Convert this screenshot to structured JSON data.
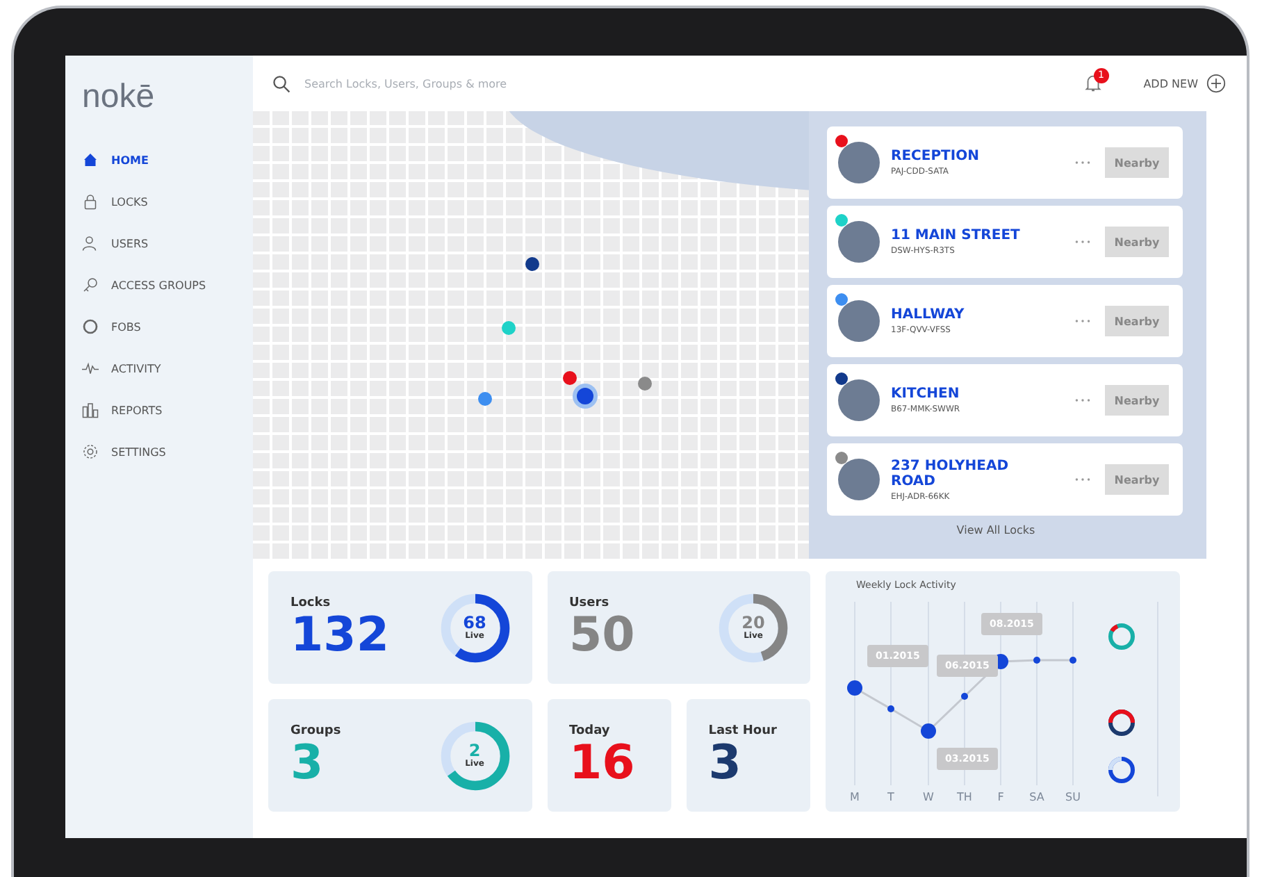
{
  "logo": "nokē",
  "nav": [
    {
      "label": "HOME",
      "selected": true
    },
    {
      "label": "LOCKS",
      "selected": false
    },
    {
      "label": "USERS",
      "selected": false
    },
    {
      "label": "ACCESS GROUPS",
      "selected": false
    },
    {
      "label": "FOBS",
      "selected": false
    },
    {
      "label": "ACTIVITY",
      "selected": false
    },
    {
      "label": "REPORTS",
      "selected": false
    },
    {
      "label": "SETTINGS",
      "selected": false
    }
  ],
  "search": {
    "placeholder": "Search Locks, Users, Groups & more"
  },
  "notifications": {
    "count": "1"
  },
  "add_new": "ADD NEW",
  "locks": [
    {
      "name": "RECEPTION",
      "code": "PAJ-CDD-SATA",
      "color": "#e8101c",
      "action": "Nearby"
    },
    {
      "name": "11 MAIN STREET",
      "code": "DSW-HYS-R3TS",
      "color": "#1ed2c8",
      "action": "Nearby"
    },
    {
      "name": "HALLWAY",
      "code": "13F-QVV-VFSS",
      "color": "#3d8ef0",
      "action": "Nearby"
    },
    {
      "name": "KITCHEN",
      "code": "B67-MMK-SWWR",
      "color": "#123a8c",
      "action": "Nearby"
    },
    {
      "name": "237 HOLYHEAD ROAD",
      "code": "EHJ-ADR-66KK",
      "color": "#8a8a8a",
      "action": "Nearby"
    }
  ],
  "view_all": "View All Locks",
  "stats": [
    {
      "label": "Locks",
      "value": "132",
      "color": "#1446d8",
      "live": {
        "value": "68",
        "label": "Live",
        "level": 0.6,
        "color": "#1446d8"
      }
    },
    {
      "label": "Users",
      "value": "50",
      "color": "#858585",
      "live": {
        "value": "20",
        "label": "Live",
        "level": 0.45,
        "color": "#858585"
      }
    },
    {
      "label": "Groups",
      "value": "3",
      "color": "#18b0a8",
      "live": {
        "value": "2",
        "label": "Live",
        "level": 0.65,
        "color": "#18b0a8"
      }
    },
    {
      "label": "Today",
      "value": "16",
      "color": "#e8101c"
    },
    {
      "label": "Last Hour",
      "value": "3",
      "color": "#1c3a6e"
    }
  ],
  "activity": {
    "title": "Weekly Lock Activity",
    "days": [
      "M",
      "T",
      "W",
      "TH",
      "F",
      "SA",
      "SU"
    ],
    "callouts": [
      "01.2015",
      "06.2015",
      "08.2015",
      "03.2015"
    ]
  }
}
